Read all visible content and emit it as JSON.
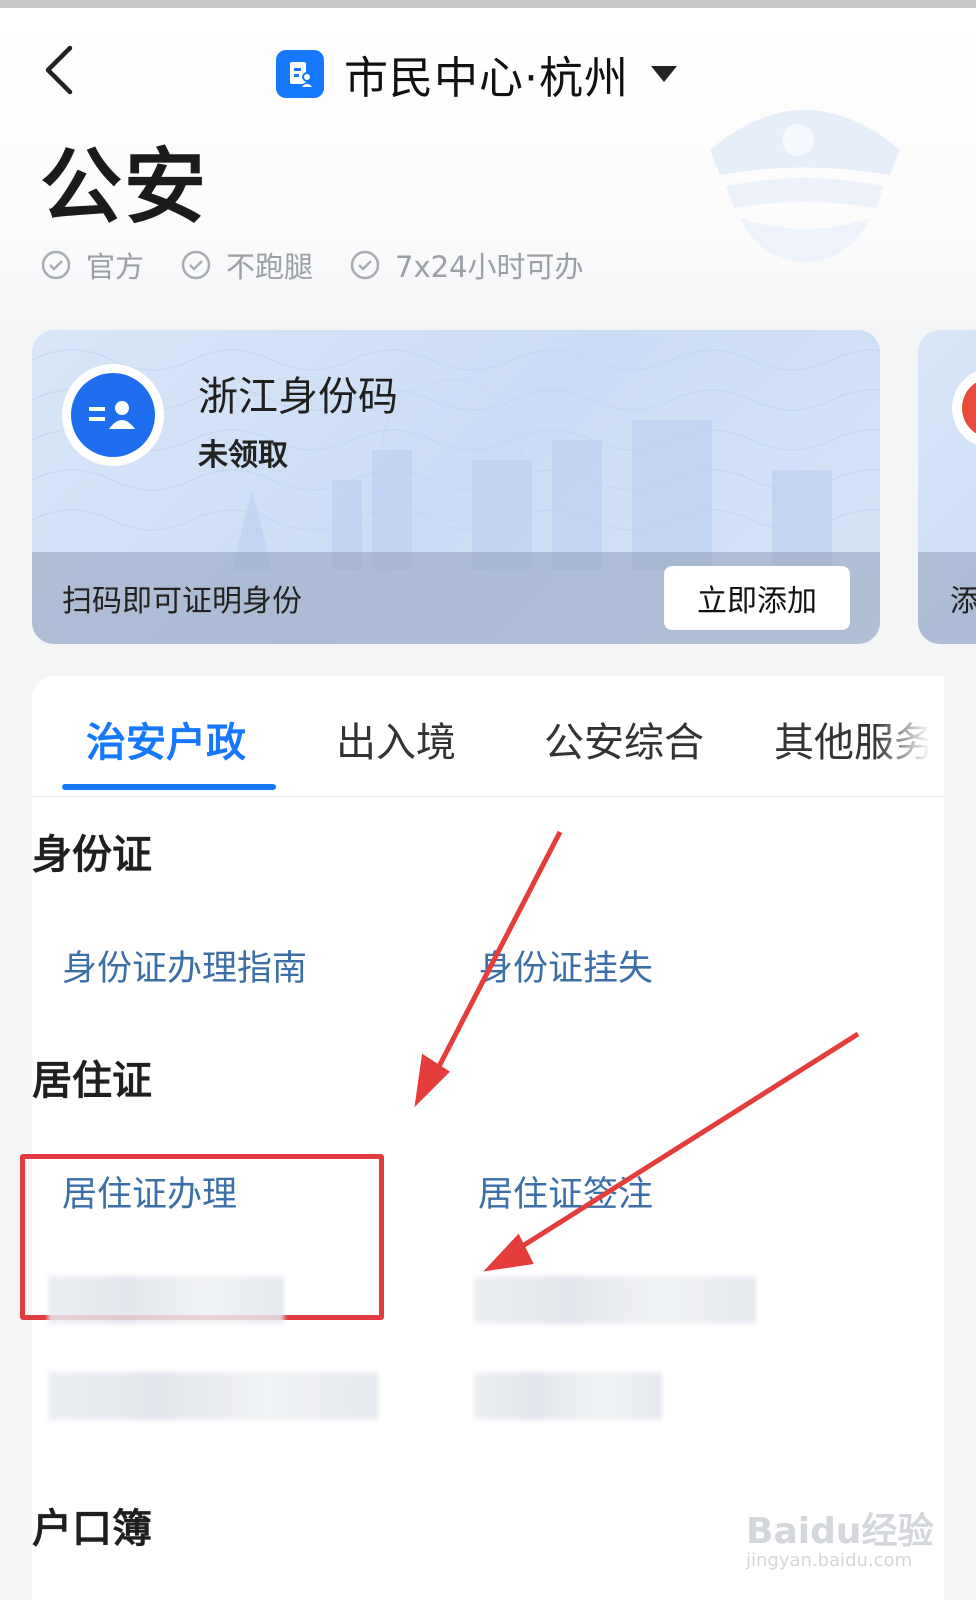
{
  "nav": {
    "title": "市民中心·杭州",
    "back_icon": "back-arrow-icon",
    "app_icon": "citizen-center-icon",
    "dropdown_icon": "caret-down-icon"
  },
  "page": {
    "title": "公安",
    "tags": [
      "官方",
      "不跑腿",
      "7x24小时可办"
    ]
  },
  "id_card": {
    "title": "浙江身份码",
    "status": "未领取",
    "hint": "扫码即可证明身份",
    "action_label": "立即添加",
    "next_card_label": "添"
  },
  "tabs": [
    {
      "label": "治安户政",
      "active": true
    },
    {
      "label": "出入境",
      "active": false
    },
    {
      "label": "公安综合",
      "active": false
    },
    {
      "label": "其他服务",
      "active": false
    }
  ],
  "sections": {
    "id": {
      "title": "身份证",
      "links": [
        "身份证办理指南",
        "身份证挂失"
      ]
    },
    "residence": {
      "title": "居住证",
      "links": [
        "居住证办理",
        "居住证签注"
      ]
    },
    "household": {
      "title": "户口簿"
    }
  },
  "colors": {
    "accent": "#1677ff",
    "link": "#3c6fa8",
    "annotation": "#e23b3f"
  },
  "watermark": {
    "brand": "Baidu经验",
    "url": "jingyan.baidu.com"
  }
}
